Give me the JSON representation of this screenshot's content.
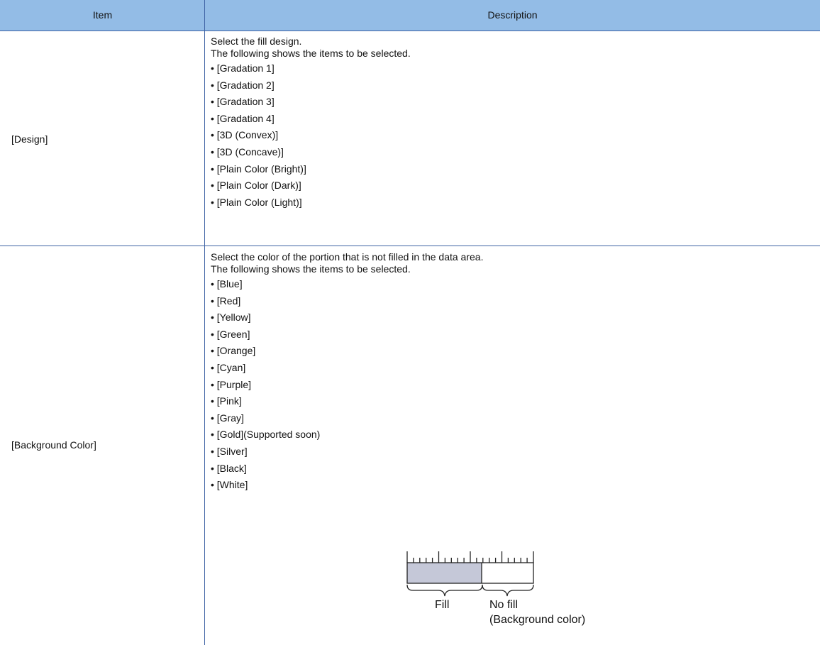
{
  "table": {
    "header": {
      "item": "Item",
      "description": "Description"
    },
    "rows": [
      {
        "item": "[Design]",
        "intro": [
          "Select the fill design.",
          "The following shows the items to be selected."
        ],
        "options": [
          "• [Gradation 1]",
          "• [Gradation 2]",
          "• [Gradation 3]",
          "• [Gradation 4]",
          "• [3D (Convex)]",
          "• [3D (Concave)]",
          "• [Plain Color (Bright)]",
          "• [Plain Color (Dark)]",
          "• [Plain Color (Light)]"
        ]
      },
      {
        "item": "[Background Color]",
        "intro": [
          "Select the color of the portion that is not filled in the data area.",
          "The following shows the items to be selected."
        ],
        "options": [
          "• [Blue]",
          "• [Red]",
          "• [Yellow]",
          "• [Green]",
          "• [Orange]",
          "• [Cyan]",
          "• [Purple]",
          "• [Pink]",
          "• [Gray]",
          "• [Gold](Supported soon)",
          "• [Silver]",
          "• [Black]",
          "• [White]"
        ],
        "figure": {
          "fill_label": "Fill",
          "nofill_label_line1": "No fill",
          "nofill_label_line2": "(Background color)",
          "fill_color": "#c5c8d8",
          "fill_fraction": 0.59
        }
      }
    ]
  },
  "colors": {
    "header_bg": "#93bce6",
    "rule": "#3f63a5"
  }
}
